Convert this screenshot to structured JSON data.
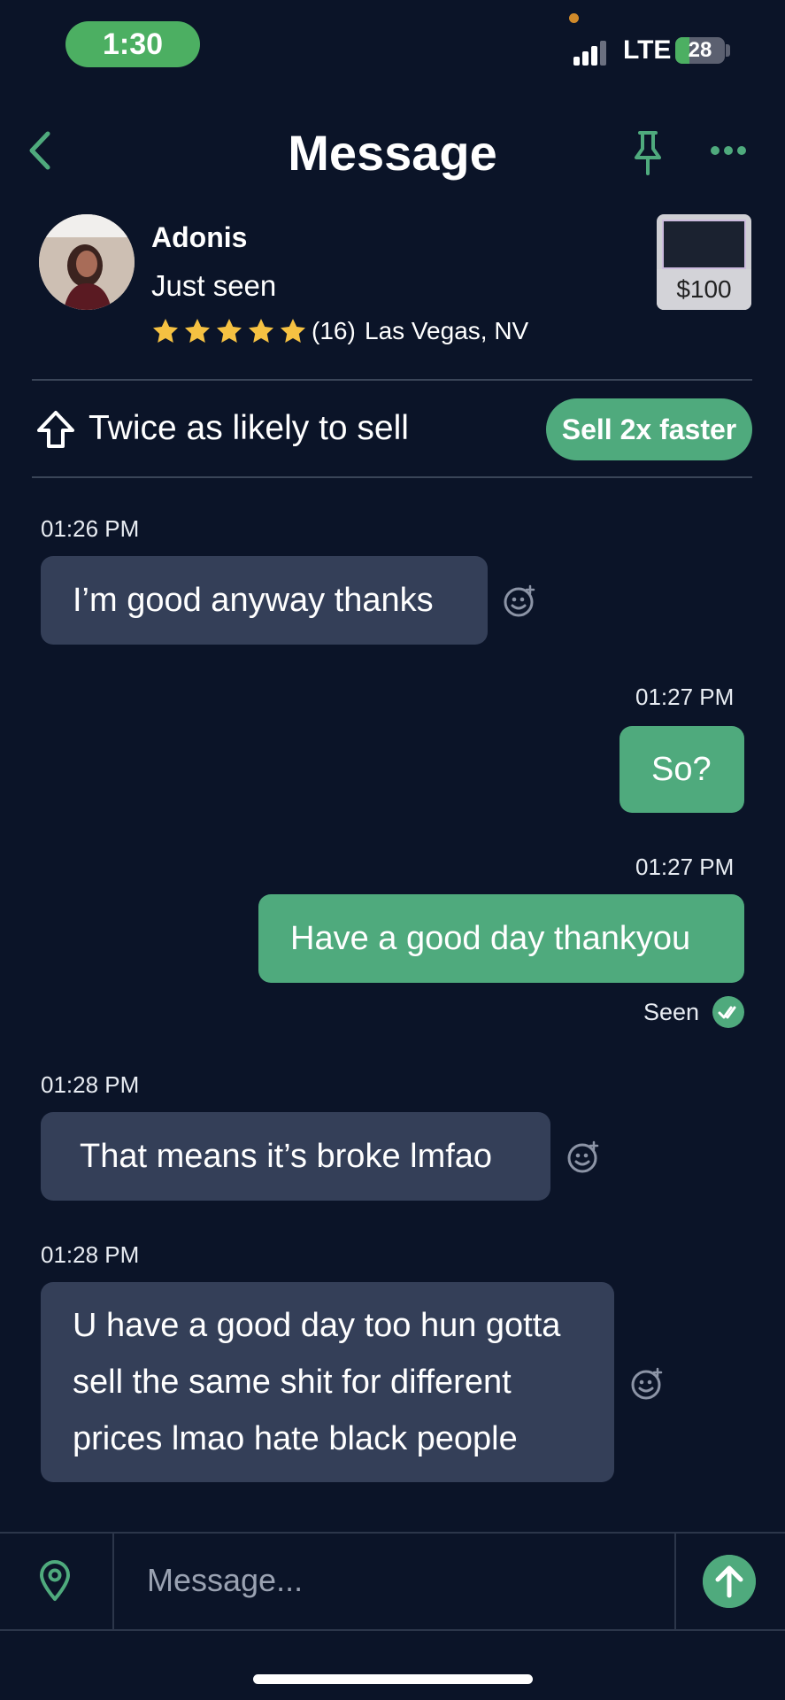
{
  "status_bar": {
    "time": "1:30",
    "network": "LTE",
    "battery": "28",
    "battery_level_fraction": 0.28
  },
  "header": {
    "title": "Message",
    "back_icon": "chevron-left-icon",
    "pin_icon": "pin-icon",
    "more_icon": "more-horizontal-icon"
  },
  "profile": {
    "name": "Adonis",
    "status": "Just seen",
    "star_rating": 5,
    "rating_count": "(16)",
    "location": "Las Vegas, NV",
    "listing_price": "$100"
  },
  "promo": {
    "text": "Twice as likely to sell",
    "button_label": "Sell 2x faster",
    "icon": "arrow-up-outline-icon"
  },
  "messages": [
    {
      "time": "01:26 PM",
      "side": "in",
      "lines": [
        "I’m good anyway thanks"
      ]
    },
    {
      "time": "01:27 PM",
      "side": "out",
      "lines": [
        "So?"
      ]
    },
    {
      "time": "01:27 PM",
      "side": "out",
      "lines": [
        "Have a good day thankyou"
      ]
    },
    {
      "time": "01:28 PM",
      "side": "in",
      "lines": [
        "That means it’s broke lmfao"
      ]
    },
    {
      "time": "01:28 PM",
      "side": "in",
      "lines": [
        "U have a good day too hun gotta",
        "sell the same shit for different",
        "prices lmao hate black people"
      ]
    }
  ],
  "seen_receipt": "Seen",
  "composer": {
    "placeholder": "Message...",
    "location_icon": "location-pin-icon",
    "send_icon": "send-arrow-up-icon"
  },
  "colors": {
    "background": "#0b1428",
    "accent": "#4faa7d",
    "incoming_bubble": "#343f58",
    "star": "#f5c142"
  }
}
